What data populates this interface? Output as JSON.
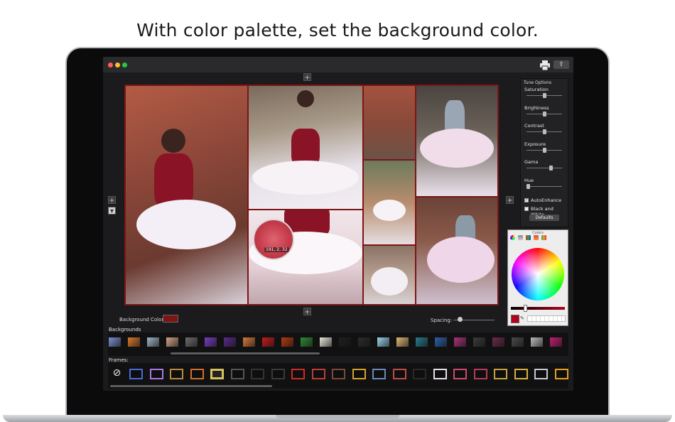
{
  "caption": "With color palette, set the background color.",
  "window": {
    "traffic_lights": [
      "#fe5f57",
      "#febc2e",
      "#28c840"
    ],
    "print_icon": "printer-icon",
    "share_icon": "share-icon",
    "share_glyph": "⇪"
  },
  "add_glyph": "+",
  "collage": {
    "background_color": "#7d1416",
    "magnifier_value": "191, 2, 32"
  },
  "tune_options": {
    "title": "Tune Options",
    "sliders": [
      {
        "label": "Saturation",
        "value": 0.5
      },
      {
        "label": "Brightness",
        "value": 0.5
      },
      {
        "label": "Contrast",
        "value": 0.5
      },
      {
        "label": "Exposure",
        "value": 0.5
      },
      {
        "label": "Gama",
        "value": 0.72
      },
      {
        "label": "Hue",
        "value": 0.0
      }
    ],
    "auto_enhance_label": "AutoEnhance",
    "auto_enhance_checked": true,
    "black_white_label": "Black and White",
    "black_white_checked": false,
    "defaults_label": "Defaults"
  },
  "colors_panel": {
    "title": "Colors",
    "selected_color": "#b3031a",
    "eyedropper_glyph": "✎"
  },
  "bottom_bar": {
    "background_color_label": "Background Color:",
    "background_color_value": "#7d1416",
    "spacing_label": "Spacing:",
    "spacing_value": 0.15
  },
  "backgrounds": {
    "label": "Backgrounds",
    "swatches": [
      "#7a8fd0",
      "#d97a2b",
      "#9fb6c4",
      "#d3a48a",
      "#6e6e6e",
      "#7a3cc0",
      "#5a2a8a",
      "#d67a3a",
      "#c61b1b",
      "#b23a12",
      "#2f8a35",
      "#e8e6d8",
      "#1f1f1f",
      "#2b2b2b",
      "#9ad4ec",
      "#e0b877",
      "#2a7a8c",
      "#2f5fa8",
      "#a8347a",
      "#3b3b3b",
      "#6a2b4b",
      "#4a4a4a",
      "#bdbdbd",
      "#c02070"
    ]
  },
  "frames": {
    "label": "Frames:",
    "none_glyph": "⃠",
    "items": [
      {
        "color": "#4a6ad8",
        "selected": false
      },
      {
        "color": "#a878e8",
        "selected": false
      },
      {
        "color": "#b88a3a",
        "selected": false
      },
      {
        "color": "#d0702a",
        "selected": false
      },
      {
        "color": "#d8c060",
        "selected": true
      },
      {
        "color": "#555555",
        "selected": false
      },
      {
        "color": "#333333",
        "selected": false
      },
      {
        "color": "#3a3a3a",
        "selected": false
      },
      {
        "color": "#d02a2a",
        "selected": false
      },
      {
        "color": "#c03a3a",
        "selected": false
      },
      {
        "color": "#7a4a3a",
        "selected": false
      },
      {
        "color": "#d8a030",
        "selected": false
      },
      {
        "color": "#6a8ab8",
        "selected": false
      },
      {
        "color": "#c04a4a",
        "selected": false
      },
      {
        "color": "#2a2a2a",
        "selected": false
      },
      {
        "color": "#e8e0e8",
        "selected": false
      },
      {
        "color": "#d04a6a",
        "selected": false
      },
      {
        "color": "#b83a5a",
        "selected": false
      },
      {
        "color": "#c8a040",
        "selected": false
      },
      {
        "color": "#d8b040",
        "selected": false
      },
      {
        "color": "#c8c8d8",
        "selected": false
      },
      {
        "color": "#e8a020",
        "selected": false
      }
    ]
  }
}
